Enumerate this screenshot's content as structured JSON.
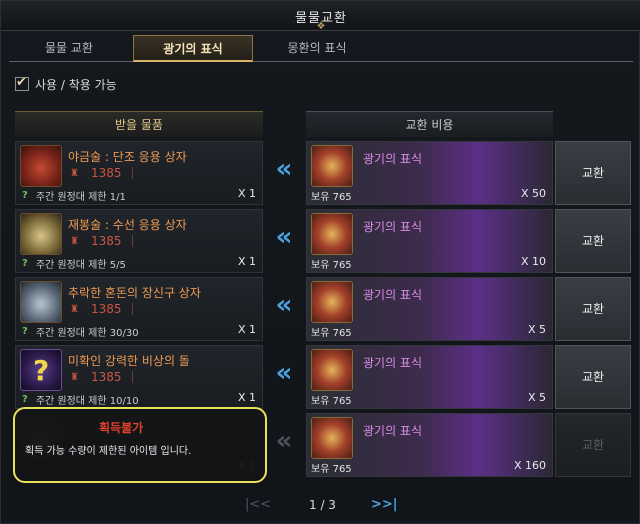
{
  "window": {
    "title": "물물교환",
    "deco": "❖"
  },
  "tabs": [
    {
      "label": "물물 교환"
    },
    {
      "label": "광기의 표식",
      "active": true
    },
    {
      "label": "몽환의 표식"
    }
  ],
  "filter": {
    "label": "사용 / 착용 가능",
    "checked": true
  },
  "columns": {
    "receive": "받을 물품",
    "cost": "교환 비용"
  },
  "rows": [
    {
      "name": "야금술 : 단조 응용 상자",
      "level": "1385",
      "limit": "주간 원정대 제한 1/1",
      "qty": "X 1",
      "cost_name": "광기의 표식",
      "cost_own": "보유 765",
      "cost_qty": "X 50",
      "button": "교환",
      "icon": "chest-red-icon"
    },
    {
      "name": "재봉술 : 수선 응용 상자",
      "level": "1385",
      "limit": "주간 원정대 제한 5/5",
      "qty": "X 1",
      "cost_name": "광기의 표식",
      "cost_own": "보유 765",
      "cost_qty": "X 10",
      "button": "교환",
      "icon": "chest-gold-icon"
    },
    {
      "name": "추락한 혼돈의 장신구 상자",
      "level": "1385",
      "limit": "주간 원정대 제한 30/30",
      "qty": "X 1",
      "cost_name": "광기의 표식",
      "cost_own": "보유 765",
      "cost_qty": "X 5",
      "button": "교환",
      "icon": "chest-silver-icon"
    },
    {
      "name": "미확인 강력한 비상의 돌",
      "level": "1385",
      "limit": "주간 원정대 제한 10/10",
      "qty": "X 1",
      "cost_name": "광기의 표식",
      "cost_own": "보유 765",
      "cost_qty": "X 5",
      "button": "교환",
      "icon": "unknown-stone-icon"
    },
    {
      "name": "",
      "level": "",
      "limit": "",
      "qty": "X 1",
      "cost_name": "광기의 표식",
      "cost_own": "보유 765",
      "cost_qty": "X 160",
      "button": "교환",
      "icon": "faded-item-icon"
    }
  ],
  "tooltip": {
    "title": "획득불가",
    "body": "획득 가능 수량이 제한된 아이템 입니다."
  },
  "pager": {
    "prev": "|<<",
    "page": "1 / 3",
    "next": ">>|"
  },
  "colors": {
    "accent": "#d9b56a",
    "arrow": "#4aa3e0",
    "cost_name": "#d68be6",
    "item_name": "#ee9a52",
    "warning": "#e3402e"
  }
}
